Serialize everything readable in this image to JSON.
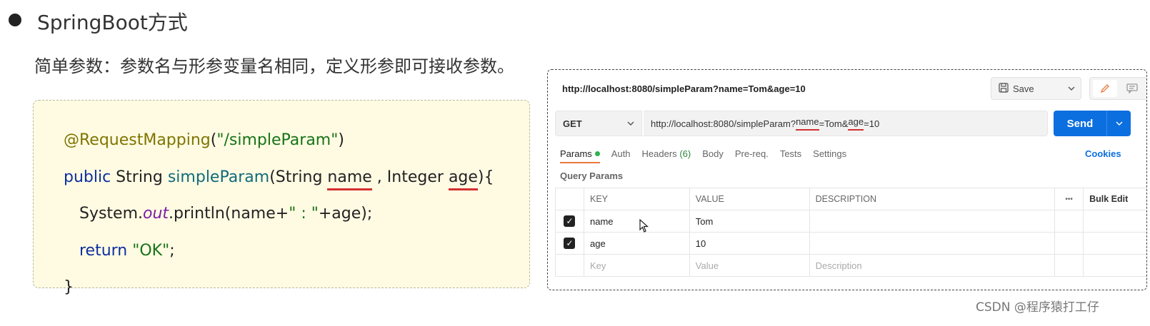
{
  "heading": "SpringBoot方式",
  "subtext": "简单参数：参数名与形参变量名相同，定义形参即可接收参数。",
  "code": {
    "line1": {
      "annotation": "@RequestMapping",
      "open": "(",
      "string": "\"/simpleParam\"",
      "close": ")"
    },
    "line2": {
      "kw": "public",
      "type": " String ",
      "method": "simpleParam",
      "args1": "(String ",
      "name": "name",
      "args2": " , Integer ",
      "age": "age",
      "end": "){"
    },
    "line3": {
      "obj": "System.",
      "field": "out",
      "rest": ".println(name+",
      "string": "\" : \"",
      "end": "+age);"
    },
    "line4": {
      "kw": "return ",
      "string": "\"OK\"",
      "end": ";"
    },
    "line5": "}"
  },
  "postman": {
    "title_url": "http://localhost:8080/simpleParam?name=Tom&age=10",
    "save_label": "Save",
    "method": "GET",
    "url": {
      "prefix": "http://localhost:8080/simpleParam?",
      "name": "name",
      "mid": "=Tom&",
      "age": "age",
      "suffix": "=10"
    },
    "send_label": "Send",
    "tabs": [
      {
        "label": "Params",
        "active": true
      },
      {
        "label": "Auth"
      },
      {
        "label": "Headers",
        "count": "(6)"
      },
      {
        "label": "Body"
      },
      {
        "label": "Pre-req."
      },
      {
        "label": "Tests"
      },
      {
        "label": "Settings"
      }
    ],
    "cookies_label": "Cookies",
    "query_params_label": "Query Params",
    "table": {
      "headers": [
        "KEY",
        "VALUE",
        "DESCRIPTION",
        "•••",
        "Bulk Edit"
      ],
      "rows": [
        {
          "checked": true,
          "key": "name",
          "value": "Tom"
        },
        {
          "checked": true,
          "key": "age",
          "value": "10"
        }
      ],
      "placeholders": {
        "key": "Key",
        "value": "Value",
        "description": "Description"
      }
    }
  },
  "watermark": "CSDN @程序猿打工仔",
  "colors": {
    "send": "#0c6fe0",
    "underline": "#d32f2f",
    "code_bg": "#fffbe3",
    "params_accent": "#e9793e"
  }
}
